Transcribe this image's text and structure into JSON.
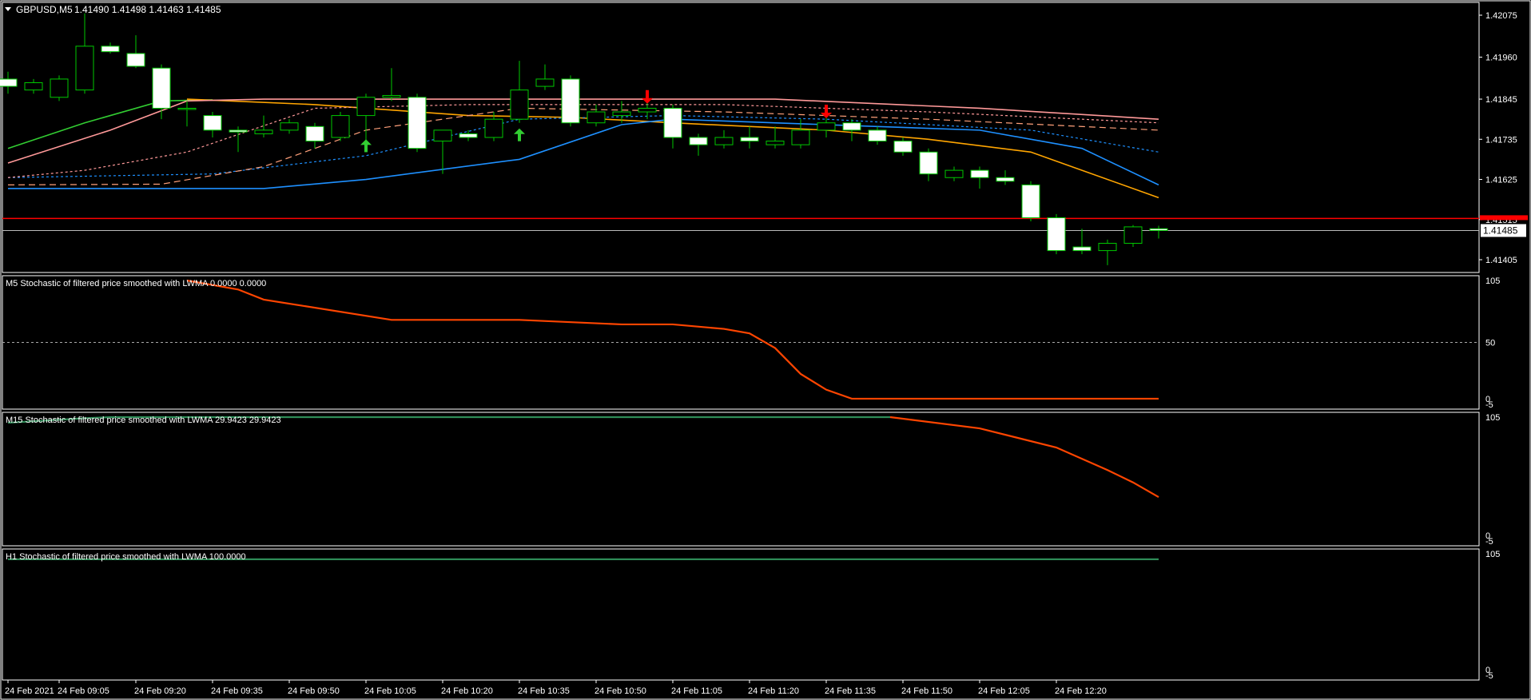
{
  "header": {
    "symbol_label": "GBPUSD,M5",
    "ohlc": "1.41490 1.41498 1.41463 1.41485"
  },
  "colors": {
    "background": "#000000",
    "axis": "#ffffff",
    "bull_candle": "#000000",
    "bear_candle": "#ffffff",
    "wick": "#00c800",
    "ma_fast": "#32cd32",
    "ma_orange": "#ffa500",
    "ma_blue": "#1e90ff",
    "ma_pink": "#ff9999",
    "stoch_down": "#ff4500",
    "stoch_up": "#2e8b57",
    "arrow_up": "#32cd32",
    "arrow_down": "#ff0000",
    "current_price_bg": "#ffffff",
    "resistance_line": "#ff0000"
  },
  "chart_data": [
    {
      "type": "candlestick",
      "title": "GBPUSD,M5",
      "y_ticks": [
        "1.42075",
        "1.41960",
        "1.41845",
        "1.41735",
        "1.41625",
        "1.41515",
        "1.41405"
      ],
      "y_range": [
        1.4137,
        1.4211
      ],
      "current_price": "1.41485",
      "red_line_price": 1.41518,
      "x_ticks": [
        "24 Feb 2021",
        "24 Feb 09:05",
        "24 Feb 09:20",
        "24 Feb 09:35",
        "24 Feb 09:50",
        "24 Feb 10:05",
        "24 Feb 10:20",
        "24 Feb 10:35",
        "24 Feb 10:50",
        "24 Feb 11:05",
        "24 Feb 11:20",
        "24 Feb 11:35",
        "24 Feb 11:50",
        "24 Feb 12:05",
        "24 Feb 12:20"
      ],
      "candles": [
        {
          "o": 1.419,
          "h": 1.4192,
          "l": 1.4186,
          "c": 1.4188
        },
        {
          "o": 1.4187,
          "h": 1.419,
          "l": 1.4186,
          "c": 1.4189
        },
        {
          "o": 1.4185,
          "h": 1.4191,
          "l": 1.4184,
          "c": 1.419
        },
        {
          "o": 1.4187,
          "h": 1.4208,
          "l": 1.4186,
          "c": 1.4199
        },
        {
          "o": 1.4199,
          "h": 1.42,
          "l": 1.4197,
          "c": 1.41975
        },
        {
          "o": 1.4197,
          "h": 1.4202,
          "l": 1.4193,
          "c": 1.41935
        },
        {
          "o": 1.4193,
          "h": 1.4194,
          "l": 1.4179,
          "c": 1.4182
        },
        {
          "o": 1.4182,
          "h": 1.4184,
          "l": 1.4177,
          "c": 1.4182
        },
        {
          "o": 1.418,
          "h": 1.4181,
          "l": 1.4174,
          "c": 1.4176
        },
        {
          "o": 1.4176,
          "h": 1.4177,
          "l": 1.417,
          "c": 1.41755
        },
        {
          "o": 1.4175,
          "h": 1.418,
          "l": 1.4174,
          "c": 1.4176
        },
        {
          "o": 1.4176,
          "h": 1.4179,
          "l": 1.4175,
          "c": 1.4178
        },
        {
          "o": 1.4177,
          "h": 1.4178,
          "l": 1.4171,
          "c": 1.4173
        },
        {
          "o": 1.4174,
          "h": 1.4181,
          "l": 1.4173,
          "c": 1.418
        },
        {
          "o": 1.418,
          "h": 1.4186,
          "l": 1.4171,
          "c": 1.4185
        },
        {
          "o": 1.4185,
          "h": 1.4193,
          "l": 1.4184,
          "c": 1.41855
        },
        {
          "o": 1.4185,
          "h": 1.4186,
          "l": 1.417,
          "c": 1.4171
        },
        {
          "o": 1.4173,
          "h": 1.4176,
          "l": 1.4164,
          "c": 1.4176
        },
        {
          "o": 1.4175,
          "h": 1.4176,
          "l": 1.4173,
          "c": 1.4174
        },
        {
          "o": 1.4174,
          "h": 1.4181,
          "l": 1.4173,
          "c": 1.4179
        },
        {
          "o": 1.4179,
          "h": 1.4195,
          "l": 1.4178,
          "c": 1.4187
        },
        {
          "o": 1.4188,
          "h": 1.4194,
          "l": 1.4187,
          "c": 1.419
        },
        {
          "o": 1.419,
          "h": 1.4191,
          "l": 1.4177,
          "c": 1.4178
        },
        {
          "o": 1.4178,
          "h": 1.4183,
          "l": 1.4177,
          "c": 1.4181
        },
        {
          "o": 1.418,
          "h": 1.4184,
          "l": 1.4178,
          "c": 1.4181
        },
        {
          "o": 1.4181,
          "h": 1.4185,
          "l": 1.4179,
          "c": 1.4182
        },
        {
          "o": 1.4182,
          "h": 1.4183,
          "l": 1.4171,
          "c": 1.4174
        },
        {
          "o": 1.4174,
          "h": 1.4175,
          "l": 1.4169,
          "c": 1.4172
        },
        {
          "o": 1.4172,
          "h": 1.4176,
          "l": 1.4171,
          "c": 1.4174
        },
        {
          "o": 1.4174,
          "h": 1.4177,
          "l": 1.4171,
          "c": 1.4173
        },
        {
          "o": 1.4172,
          "h": 1.4177,
          "l": 1.4171,
          "c": 1.4173
        },
        {
          "o": 1.4172,
          "h": 1.4179,
          "l": 1.4171,
          "c": 1.4176
        },
        {
          "o": 1.4176,
          "h": 1.418,
          "l": 1.4174,
          "c": 1.4178
        },
        {
          "o": 1.4178,
          "h": 1.4179,
          "l": 1.4173,
          "c": 1.4176
        },
        {
          "o": 1.4176,
          "h": 1.4177,
          "l": 1.4172,
          "c": 1.4173
        },
        {
          "o": 1.4173,
          "h": 1.4174,
          "l": 1.4169,
          "c": 1.417
        },
        {
          "o": 1.417,
          "h": 1.4171,
          "l": 1.4162,
          "c": 1.4164
        },
        {
          "o": 1.4163,
          "h": 1.4166,
          "l": 1.4162,
          "c": 1.4165
        },
        {
          "o": 1.4165,
          "h": 1.4166,
          "l": 1.416,
          "c": 1.4163
        },
        {
          "o": 1.4163,
          "h": 1.4165,
          "l": 1.4161,
          "c": 1.4162
        },
        {
          "o": 1.4161,
          "h": 1.4162,
          "l": 1.4151,
          "c": 1.4152
        },
        {
          "o": 1.4152,
          "h": 1.4153,
          "l": 1.4142,
          "c": 1.4143
        },
        {
          "o": 1.4144,
          "h": 1.4149,
          "l": 1.4142,
          "c": 1.4143
        },
        {
          "o": 1.4143,
          "h": 1.4146,
          "l": 1.4139,
          "c": 1.4145
        },
        {
          "o": 1.4145,
          "h": 1.415,
          "l": 1.4144,
          "c": 1.41495
        },
        {
          "o": 1.4149,
          "h": 1.41498,
          "l": 1.41463,
          "c": 1.41485
        }
      ],
      "ma_lines": [
        {
          "color": "#32cd32",
          "dash": "solid",
          "points": [
            [
              0,
              1.4171
            ],
            [
              3,
              1.4178
            ],
            [
              6,
              1.4184
            ],
            [
              8,
              1.41843
            ]
          ]
        },
        {
          "color": "#ffa500",
          "dash": "solid",
          "points": [
            [
              7,
              1.41845
            ],
            [
              12,
              1.4183
            ],
            [
              18,
              1.418
            ],
            [
              22,
              1.41795
            ],
            [
              26,
              1.4178
            ],
            [
              32,
              1.4176
            ],
            [
              36,
              1.41735
            ],
            [
              40,
              1.417
            ],
            [
              42,
              1.4165
            ],
            [
              45,
              1.41575
            ]
          ]
        },
        {
          "color": "#1e90ff",
          "dash": "solid",
          "points": [
            [
              0,
              1.416
            ],
            [
              10,
              1.416
            ],
            [
              14,
              1.41625
            ],
            [
              20,
              1.4168
            ],
            [
              24,
              1.41775
            ],
            [
              26,
              1.4179
            ],
            [
              32,
              1.41775
            ],
            [
              38,
              1.4176
            ],
            [
              42,
              1.4171
            ],
            [
              45,
              1.4161
            ]
          ]
        },
        {
          "color": "#1e90ff",
          "dash": "dot",
          "points": [
            [
              0,
              1.4163
            ],
            [
              8,
              1.4164
            ],
            [
              14,
              1.4169
            ],
            [
              20,
              1.4179
            ],
            [
              26,
              1.418
            ],
            [
              32,
              1.4179
            ],
            [
              40,
              1.4176
            ],
            [
              45,
              1.417
            ]
          ]
        },
        {
          "color": "#ffa07a",
          "dash": "dash",
          "points": [
            [
              0,
              1.4161
            ],
            [
              6,
              1.41612
            ],
            [
              10,
              1.4166
            ],
            [
              14,
              1.4176
            ],
            [
              20,
              1.4182
            ],
            [
              28,
              1.4181
            ],
            [
              36,
              1.4179
            ],
            [
              45,
              1.4176
            ]
          ]
        },
        {
          "color": "#ff9999",
          "dash": "solid",
          "points": [
            [
              0,
              1.4167
            ],
            [
              4,
              1.4176
            ],
            [
              7,
              1.4184
            ],
            [
              10,
              1.41845
            ],
            [
              20,
              1.41845
            ],
            [
              30,
              1.41845
            ],
            [
              38,
              1.4182
            ],
            [
              45,
              1.4179
            ]
          ]
        },
        {
          "color": "#ff9999",
          "dash": "dot",
          "points": [
            [
              0,
              1.4163
            ],
            [
              3,
              1.4165
            ],
            [
              7,
              1.417
            ],
            [
              12,
              1.4182
            ],
            [
              18,
              1.4183
            ],
            [
              28,
              1.4183
            ],
            [
              36,
              1.4181
            ],
            [
              45,
              1.4178
            ]
          ]
        }
      ],
      "arrows": [
        {
          "index": 14,
          "dir": "up",
          "price": 1.41715
        },
        {
          "index": 20,
          "dir": "up",
          "price": 1.41745
        },
        {
          "index": 25,
          "dir": "down",
          "price": 1.4185
        },
        {
          "index": 32,
          "dir": "down",
          "price": 1.4181
        }
      ]
    },
    {
      "type": "line",
      "title": "M5 Stochastic of filtered price smoothed with LWMA 0.0000 0.0000",
      "y_ticks": [
        "105",
        "50",
        "0",
        "-5"
      ],
      "y_range": [
        -5,
        105
      ],
      "level": 50,
      "series": [
        {
          "color": "#ff4500",
          "points": [
            [
              7,
              105
            ],
            [
              9,
              97
            ],
            [
              10,
              88
            ],
            [
              15,
              70
            ],
            [
              20,
              70
            ],
            [
              24,
              66
            ],
            [
              26,
              66
            ],
            [
              28,
              62
            ],
            [
              29,
              58
            ],
            [
              30,
              45
            ],
            [
              31,
              22
            ],
            [
              32,
              8
            ],
            [
              33,
              0
            ],
            [
              45,
              0
            ]
          ]
        }
      ]
    },
    {
      "type": "line",
      "title": "M15 Stochastic of filtered price smoothed with LWMA 29.9423 29.9423",
      "y_ticks": [
        "105",
        "0",
        "-5"
      ],
      "y_range": [
        -5,
        105
      ],
      "series": [
        {
          "color": "#2e8b57",
          "points": [
            [
              0,
              100
            ],
            [
              3,
              104
            ],
            [
              4,
              105
            ],
            [
              34.5,
              105
            ]
          ]
        },
        {
          "color": "#ff4500",
          "points": [
            [
              34.5,
              105
            ],
            [
              38,
              95
            ],
            [
              41,
              78
            ],
            [
              43,
              58
            ],
            [
              44,
              47
            ],
            [
              45,
              34
            ]
          ]
        }
      ]
    },
    {
      "type": "line",
      "title": "H1 Stochastic of filtered price smoothed with LWMA 100.0000",
      "y_ticks": [
        "105",
        "0",
        "-5"
      ],
      "y_range": [
        -5,
        105
      ],
      "series": [
        {
          "color": "#2e8b57",
          "points": [
            [
              0,
              100
            ],
            [
              45,
              100
            ]
          ]
        }
      ]
    }
  ]
}
